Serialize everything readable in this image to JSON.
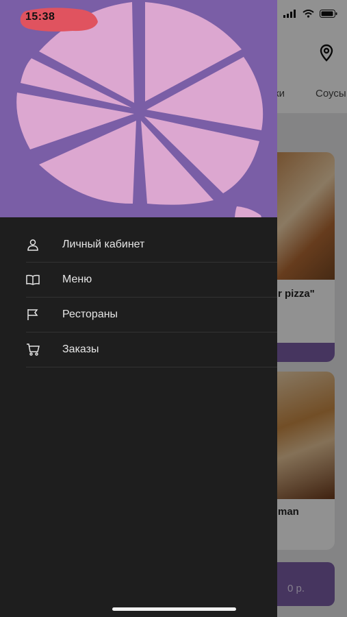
{
  "status_bar": {
    "time": "15:38"
  },
  "background": {
    "tabs": [
      "ки",
      "Соусы"
    ],
    "cards": [
      {
        "title": "r pizza\""
      },
      {
        "title": "man"
      }
    ],
    "price": "0 р."
  },
  "drawer": {
    "items": [
      {
        "label": "Личный кабинет",
        "icon": "person-icon"
      },
      {
        "label": "Меню",
        "icon": "book-icon"
      },
      {
        "label": "Рестораны",
        "icon": "flag-icon"
      },
      {
        "label": "Заказы",
        "icon": "cart-icon"
      }
    ]
  },
  "colors": {
    "brand": "#7a5ea6",
    "drawer": "#1e1e1e",
    "logo": "#dca7d0"
  }
}
